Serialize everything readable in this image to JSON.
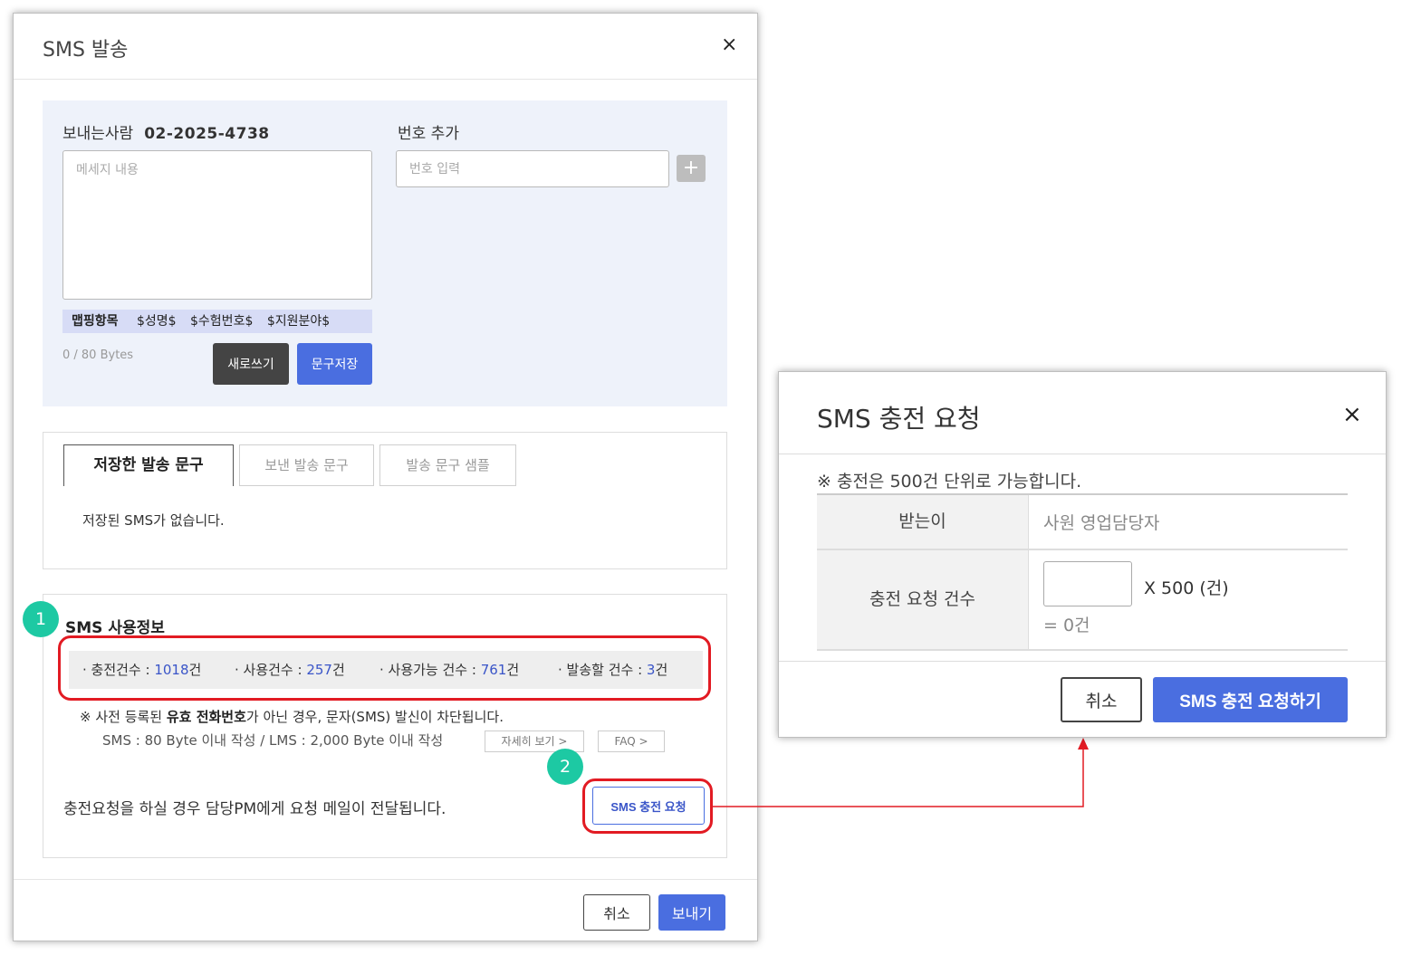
{
  "send_modal": {
    "title": "SMS 발송",
    "close_label": "×",
    "sender_label": "보내는사람",
    "sender_number": "02-2025-4738",
    "message_placeholder": "메세지 내용",
    "add_number_label": "번호 추가",
    "number_placeholder": "번호 입력",
    "add_button_label": "+",
    "mapping": {
      "title": "맵핑항목",
      "items": [
        "$성명$",
        "$수험번호$",
        "$지원분야$"
      ]
    },
    "bytes_label": "0 / 80 Bytes",
    "new_button_label": "새로쓰기",
    "save_phrase_button_label": "문구저장",
    "tabs": [
      {
        "label": "저장한 발송 문구",
        "active": true
      },
      {
        "label": "보낸 발송 문구",
        "active": false
      },
      {
        "label": "발송 문구 샘플",
        "active": false
      }
    ],
    "tab_empty_text": "저장된 SMS가 없습니다.",
    "usage": {
      "badge_1": "1",
      "badge_2": "2",
      "title": "SMS 사용정보",
      "items": [
        {
          "label": "· 충전건수 : ",
          "value": "1018",
          "unit": "건"
        },
        {
          "label": "· 사용건수 : ",
          "value": "257",
          "unit": "건"
        },
        {
          "label": "· 사용가능 건수 : ",
          "value": "761",
          "unit": "건"
        },
        {
          "label": "· 발송할 건수 : ",
          "value": "3",
          "unit": "건"
        }
      ],
      "notice_prefix": "※ 사전 등록된 ",
      "notice_bold": "유효 전화번호",
      "notice_suffix": "가 아닌 경우, 문자(SMS) 발신이 차단됩니다.",
      "notice_2": "SMS : 80 Byte 이내 작성 / LMS : 2,000 Byte 이내 작성",
      "detail_button_label": "자세히 보기 >",
      "faq_button_label": "FAQ >",
      "charge_note": "충전요청을 하실 경우 담당PM에게 요청 메일이 전달됩니다.",
      "charge_button_label": "SMS 충전 요청"
    },
    "footer": {
      "cancel_label": "취소",
      "send_label": "보내기"
    }
  },
  "charge_modal": {
    "title": "SMS 충전 요청",
    "close_label": "×",
    "note": "※ 충전은 500건 단위로 가능합니다.",
    "rows": {
      "recipient_label": "받는이",
      "recipient_value": "사원 영업담당자",
      "count_label": "충전 요청 건수",
      "count_value": "",
      "multiplier_text": "X 500 (건)",
      "total_text": "= 0건"
    },
    "cancel_label": "취소",
    "submit_label": "SMS 충전 요청하기"
  },
  "colors": {
    "accent_blue": "#4a6ee0",
    "highlight_red": "#e21b23",
    "badge_green": "#1dc9a3"
  }
}
